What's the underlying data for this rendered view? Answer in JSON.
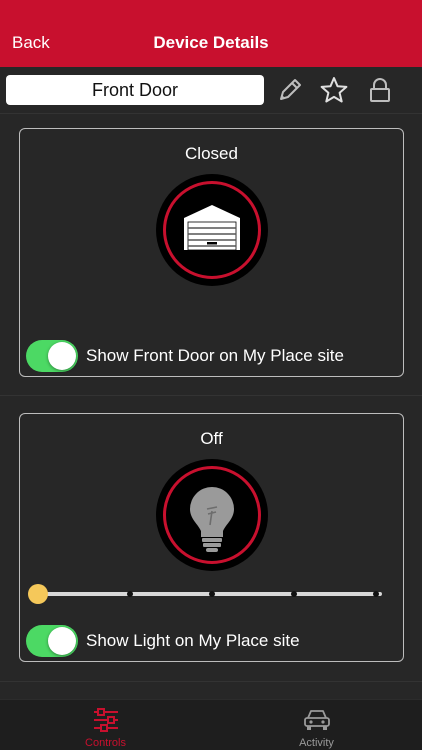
{
  "nav": {
    "back_label": "Back",
    "title": "Device Details"
  },
  "device": {
    "name": "Front Door"
  },
  "toolbar_icons": [
    "pencil-icon",
    "star-icon",
    "lock-icon"
  ],
  "door_card": {
    "status": "Closed",
    "icon": "garage-door-icon",
    "toggle_on": true,
    "toggle_label": "Show Front Door on My Place site"
  },
  "light_card": {
    "status": "Off",
    "icon": "light-bulb-icon",
    "slider_level": 0,
    "slider_steps": 5,
    "toggle_on": true,
    "toggle_label": "Show Light on My Place site"
  },
  "tabs": [
    {
      "label": "Controls",
      "icon": "sliders-icon",
      "active": true
    },
    {
      "label": "Activity",
      "icon": "car-icon",
      "active": false
    }
  ],
  "colors": {
    "brand_red": "#c8102e",
    "background": "#272727",
    "toggle_green": "#4cd964",
    "slider_thumb": "#f5c85a",
    "inactive_tab": "#9a9a9a"
  }
}
